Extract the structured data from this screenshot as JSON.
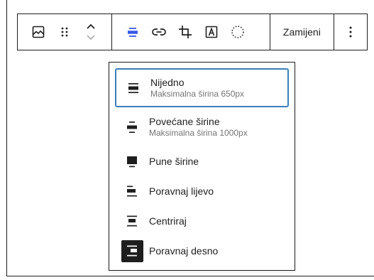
{
  "toolbar": {
    "block_icon": "image-icon",
    "drag_icon": "drag-handle-icon",
    "move_icon": "move-up-down-icon",
    "tools": [
      {
        "name": "align-icon",
        "active": true
      },
      {
        "name": "link-icon"
      },
      {
        "name": "crop-icon"
      },
      {
        "name": "text-overlay-icon"
      },
      {
        "name": "select-circle-icon"
      }
    ],
    "replace_label": "Zamijeni",
    "more_icon": "more-vertical-icon",
    "accent_color": "#3858e9"
  },
  "menu": {
    "selected_border_color": "#3a7fb9",
    "items": [
      {
        "label": "Nijedno",
        "sublabel": "Maksimalna širina 650px",
        "icon": "align-none-icon",
        "selected": true
      },
      {
        "label": "Povećane širine",
        "sublabel": "Maksimalna širina 1000px",
        "icon": "align-wide-icon"
      },
      {
        "label": "Pune širine",
        "icon": "align-full-icon"
      },
      {
        "label": "Poravnaj lijevo",
        "icon": "align-left-icon"
      },
      {
        "label": "Centriraj",
        "icon": "align-center-icon"
      },
      {
        "label": "Poravnaj desno",
        "icon": "align-right-icon",
        "highlighted": true
      }
    ]
  }
}
